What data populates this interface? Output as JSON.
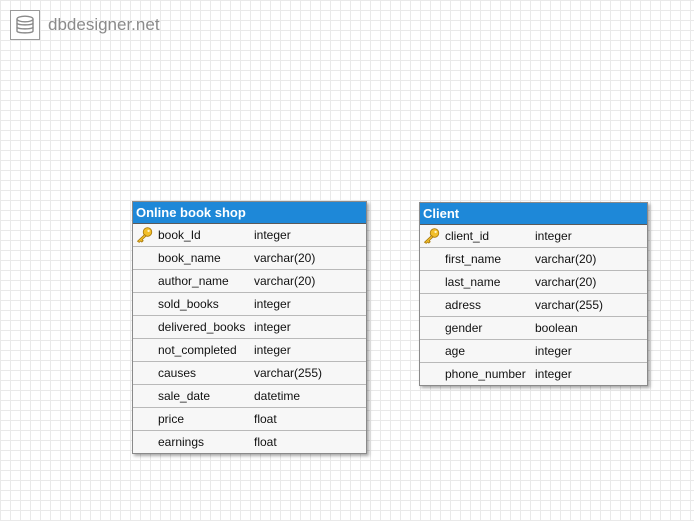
{
  "brand": {
    "name": "dbdesigner.net",
    "icon": "database-icon"
  },
  "tables": [
    {
      "title": "Online book shop",
      "columns": [
        {
          "name": "book_Id",
          "type": "integer",
          "primary_key": true
        },
        {
          "name": "book_name",
          "type": "varchar(20)"
        },
        {
          "name": "author_name",
          "type": "varchar(20)"
        },
        {
          "name": "sold_books",
          "type": "integer"
        },
        {
          "name": "delivered_books",
          "type": "integer"
        },
        {
          "name": "not_completed",
          "type": "integer"
        },
        {
          "name": "causes",
          "type": "varchar(255)"
        },
        {
          "name": "sale_date",
          "type": "datetime"
        },
        {
          "name": "price",
          "type": "float"
        },
        {
          "name": "earnings",
          "type": "float"
        }
      ]
    },
    {
      "title": "Client",
      "columns": [
        {
          "name": "client_id",
          "type": "integer",
          "primary_key": true
        },
        {
          "name": "first_name",
          "type": "varchar(20)"
        },
        {
          "name": "last_name",
          "type": "varchar(20)"
        },
        {
          "name": "adress",
          "type": "varchar(255)"
        },
        {
          "name": "gender",
          "type": "boolean"
        },
        {
          "name": "age",
          "type": "integer"
        },
        {
          "name": "phone_number",
          "type": "integer"
        }
      ]
    }
  ],
  "colors": {
    "header": "#1e88d8",
    "header_text": "#ffffff",
    "key": "#e8b21c"
  }
}
